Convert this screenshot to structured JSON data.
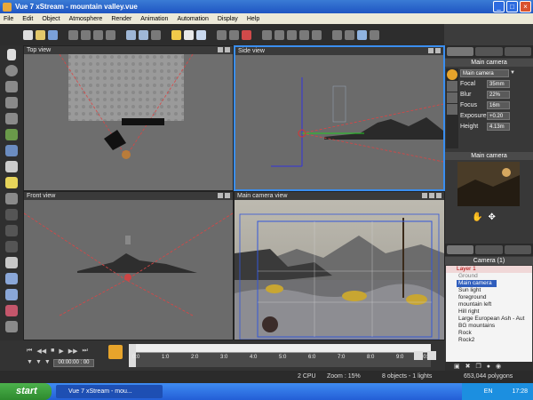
{
  "window": {
    "title": "Vue 7 xStream - mountain valley.vue",
    "buttons": [
      "_",
      "□",
      "×"
    ]
  },
  "menu": [
    "File",
    "Edit",
    "Object",
    "Atmosphere",
    "Render",
    "Animation",
    "Automation",
    "Display",
    "Help"
  ],
  "viewports": {
    "top": {
      "title": "Top view"
    },
    "side": {
      "title": "Side view"
    },
    "front": {
      "title": "Front view"
    },
    "camera": {
      "title": "Main camera view"
    }
  },
  "camera_panel": {
    "header": "Main camera",
    "dropdown": "Main camera",
    "props": [
      {
        "label": "Focal",
        "value": "35mm"
      },
      {
        "label": "Blur",
        "value": "22%"
      },
      {
        "label": "Focus",
        "value": "16m"
      },
      {
        "label": "Exposure",
        "value": "+0.20"
      },
      {
        "label": "Height",
        "value": "4.13m"
      }
    ]
  },
  "preview": {
    "header": "Main camera"
  },
  "layers": {
    "header": "Camera (1)",
    "layer": "Layer 1",
    "items": [
      "Ground",
      "Main camera",
      "Sun light",
      "foreground",
      "mountain left",
      "Hill right",
      "Large European Ash - Aut",
      "BG mountains",
      "Rock",
      "Rock2"
    ]
  },
  "timeline": {
    "time": "00:00:00 : 00",
    "ticks": [
      "0:0",
      "1:0",
      "2:0",
      "3:0",
      "4:0",
      "5:0",
      "6:0",
      "7:0",
      "8:0",
      "9:0",
      "10:0"
    ]
  },
  "status": {
    "cpu": "2 CPU",
    "zoom": "Zoom : 15%",
    "objects": "8 objects - 1 lights",
    "polygons": "653,044 polygons"
  },
  "taskbar": {
    "start": "start",
    "task": "Vue 7 xStream - mou...",
    "lang": "EN",
    "clock": "17:28"
  },
  "colors": {
    "accent": "#3a8ef0",
    "selection": "#2f5ebd"
  }
}
